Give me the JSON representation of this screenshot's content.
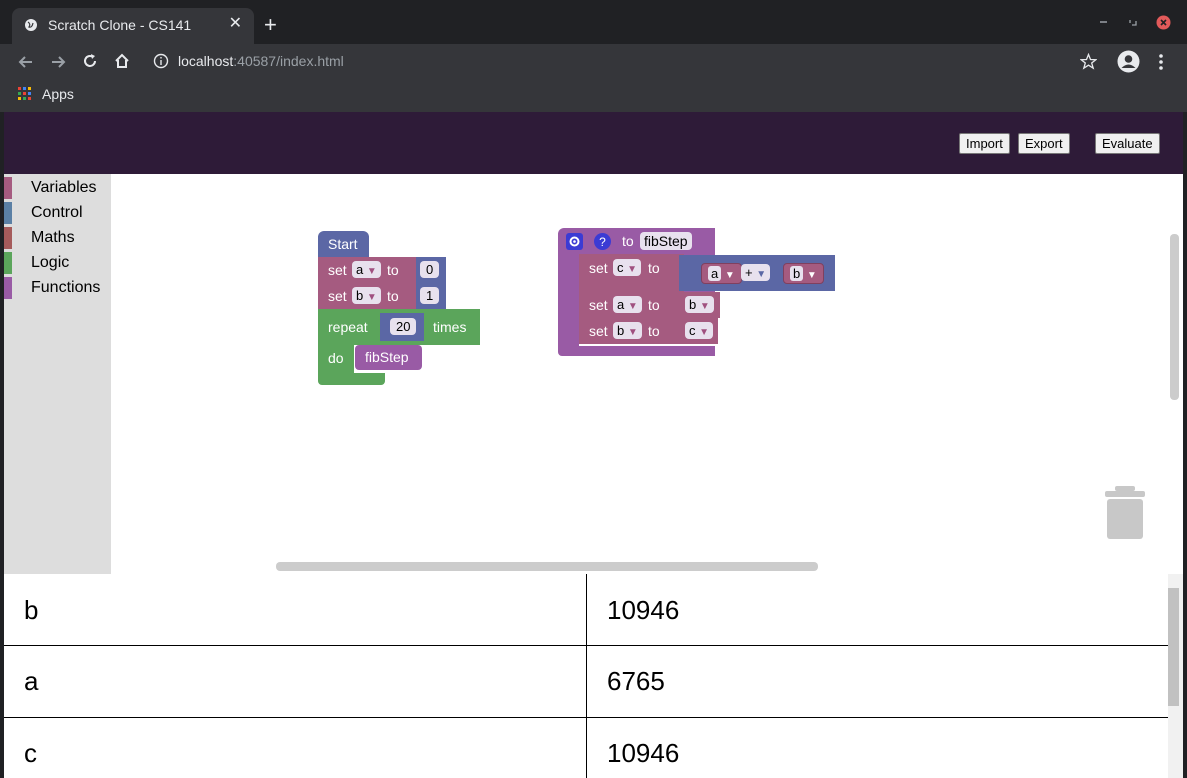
{
  "browser": {
    "tab_title": "Scratch Clone - CS141",
    "tab_close": "✕",
    "new_tab": "+",
    "url_host": "localhost",
    "url_rest": ":40587/index.html",
    "bookmarks_apps": "Apps",
    "icons": [
      "globe-icon",
      "back-icon",
      "forward-icon",
      "reload-icon",
      "home-icon",
      "info-icon",
      "star-icon",
      "account-icon",
      "menu-icon",
      "minimize-icon",
      "restore-icon",
      "close-icon",
      "apps-grid-icon"
    ]
  },
  "header": {
    "import_label": "Import",
    "export_label": "Export",
    "evaluate_label": "Evaluate",
    "bg_color": "#2e1b38"
  },
  "toolbox": {
    "categories": [
      {
        "label": "Variables",
        "color": "#a55b80"
      },
      {
        "label": "Control",
        "color": "#5b80a5"
      },
      {
        "label": "Maths",
        "color": "#a55b5b"
      },
      {
        "label": "Logic",
        "color": "#5ba55b"
      },
      {
        "label": "Functions",
        "color": "#995ba5"
      }
    ]
  },
  "blocks": {
    "start": {
      "hat": "Start",
      "set_label": "set",
      "to_label": "to",
      "set_a_var": "a",
      "set_a_value": "0",
      "set_b_var": "b",
      "set_b_value": "1",
      "repeat_label": "repeat",
      "repeat_count": "20",
      "times_label": "times",
      "do_label": "do",
      "call_name": "fibStep"
    },
    "function": {
      "to_label": "to",
      "name": "fibStep",
      "set_label": "set",
      "to_label2": "to",
      "line1_var": "c",
      "line1_left": "a",
      "line1_op": "+",
      "line1_right": "b",
      "line2_var": "a",
      "line2_value": "b",
      "line3_var": "b",
      "line3_value": "c"
    }
  },
  "results": {
    "rows": [
      {
        "name": "b",
        "value": "10946"
      },
      {
        "name": "a",
        "value": "6765"
      },
      {
        "name": "c",
        "value": "10946"
      }
    ]
  }
}
